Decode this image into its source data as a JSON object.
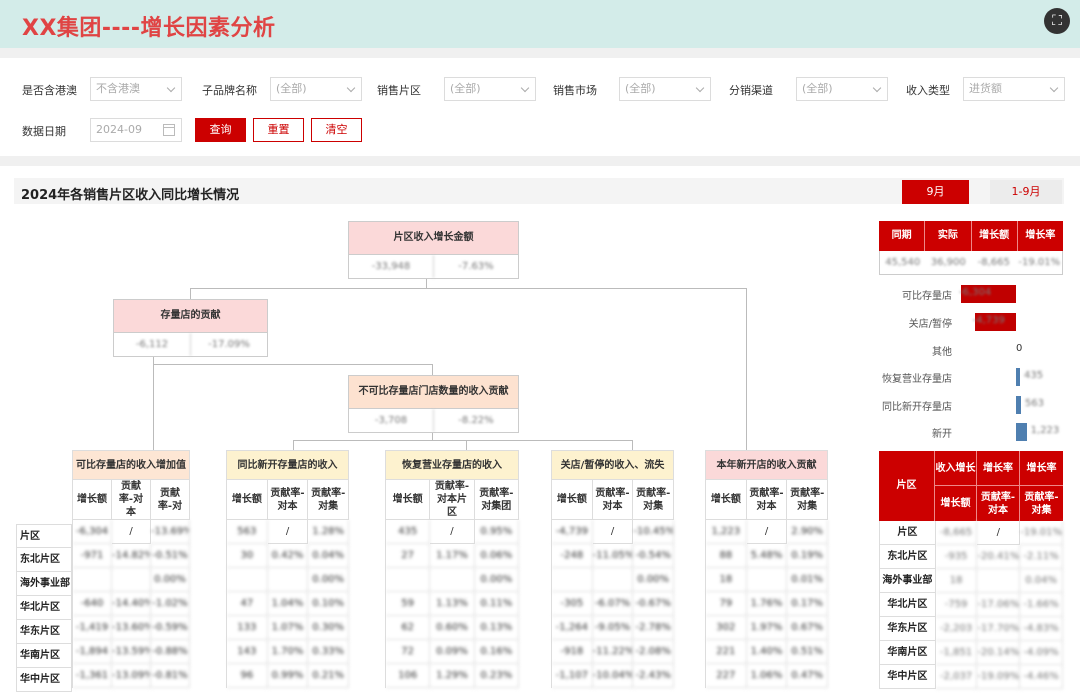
{
  "app": {
    "title": "XX集团----增长因素分析",
    "fullscreen_icon": "fullscreen-icon"
  },
  "filters": {
    "hk_macao": {
      "label": "是否含港澳",
      "value": "不含港澳"
    },
    "sub_brand": {
      "label": "子品牌名称",
      "value": "(全部)"
    },
    "sales_region": {
      "label": "销售片区",
      "value": "(全部)"
    },
    "sales_market": {
      "label": "销售市场",
      "value": "(全部)"
    },
    "channel": {
      "label": "分销渠道",
      "value": "(全部)"
    },
    "income_type": {
      "label": "收入类型",
      "value": "进货额"
    },
    "data_date": {
      "label": "数据日期",
      "value": "2024-09"
    },
    "buttons": {
      "query": "查询",
      "reset": "重置",
      "clear": "清空"
    }
  },
  "section": {
    "title": "2024年各销售片区收入同比增长情况",
    "tab_month": "9月",
    "tab_ytd": "1-9月"
  },
  "tree": {
    "root": {
      "title": "片区收入增长金额",
      "v1": "-33,948",
      "v2": "-7.63%"
    },
    "stock": {
      "title": "存量店的贡献",
      "v1": "-6,112",
      "v2": "-17.09%"
    },
    "noncomp": {
      "title": "不可比存量店门店数量的收入贡献",
      "v1": "-3,708",
      "v2": "-8.22%"
    }
  },
  "row_labels": [
    "片区",
    "东北片区",
    "海外事业部",
    "华北片区",
    "华东片区",
    "华南片区",
    "华中片区"
  ],
  "categories": [
    {
      "title": "可比存量店的收入增加值",
      "headers": [
        "增长额",
        "贡献率-对本",
        "贡献率-对"
      ],
      "rows": [
        [
          "-6,304",
          "/",
          "-13.69%"
        ],
        [
          "-971",
          "-14.82%",
          "-0.51%"
        ],
        [
          "",
          "",
          "0.00%"
        ],
        [
          "-640",
          "-14.40%",
          "-1.02%"
        ],
        [
          "-1,419",
          "-13.60%",
          "-0.59%"
        ],
        [
          "-1,894",
          "-13.59%",
          "-0.88%"
        ],
        [
          "-1,361",
          "-13.09%",
          "-0.81%"
        ]
      ]
    },
    {
      "title": "同比新开存量店的收入",
      "headers": [
        "增长额",
        "贡献率-对本",
        "贡献率-对集"
      ],
      "rows": [
        [
          "563",
          "/",
          "1.28%"
        ],
        [
          "30",
          "0.42%",
          "0.04%"
        ],
        [
          "",
          "",
          "0.00%"
        ],
        [
          "47",
          "1.04%",
          "0.10%"
        ],
        [
          "133",
          "1.07%",
          "0.30%"
        ],
        [
          "143",
          "1.70%",
          "0.33%"
        ],
        [
          "96",
          "0.99%",
          "0.21%"
        ]
      ]
    },
    {
      "title": "恢复营业存量店的收入",
      "headers": [
        "增长额",
        "贡献率-对本片区",
        "贡献率-对集团"
      ],
      "rows": [
        [
          "435",
          "/",
          "0.95%"
        ],
        [
          "27",
          "1.17%",
          "0.06%"
        ],
        [
          "",
          "",
          "0.00%"
        ],
        [
          "59",
          "1.13%",
          "0.11%"
        ],
        [
          "62",
          "0.60%",
          "0.13%"
        ],
        [
          "72",
          "0.09%",
          "0.16%"
        ],
        [
          "106",
          "1.29%",
          "0.23%"
        ]
      ]
    },
    {
      "title": "关店/暂停的收入、流失",
      "headers": [
        "增长额",
        "贡献率-对本",
        "贡献率-对集"
      ],
      "rows": [
        [
          "-4,739",
          "/",
          "-10.45%"
        ],
        [
          "-248",
          "-11.05%",
          "-0.54%"
        ],
        [
          "",
          "",
          "0.00%"
        ],
        [
          "-305",
          "-6.07%",
          "-0.67%"
        ],
        [
          "-1,264",
          "-9.05%",
          "-2.78%"
        ],
        [
          "-918",
          "-11.22%",
          "-2.08%"
        ],
        [
          "-1,107",
          "-10.04%",
          "-2.43%"
        ]
      ]
    },
    {
      "title": "本年新开店的收入贡献",
      "headers": [
        "增长额",
        "贡献率-对本",
        "贡献率-对集"
      ],
      "rows": [
        [
          "1,223",
          "/",
          "2.90%"
        ],
        [
          "88",
          "5.48%",
          "0.19%"
        ],
        [
          "18",
          "",
          "0.01%"
        ],
        [
          "79",
          "1.76%",
          "0.17%"
        ],
        [
          "302",
          "1.97%",
          "0.67%"
        ],
        [
          "221",
          "1.40%",
          "0.51%"
        ],
        [
          "227",
          "1.06%",
          "0.47%"
        ]
      ]
    }
  ],
  "right_summary": {
    "headers": [
      "同期",
      "实际",
      "增长额",
      "增长率"
    ],
    "values": [
      "45,540",
      "36,900",
      "-8,665",
      "-19.01%"
    ]
  },
  "right_bars": [
    {
      "label": "可比存量店",
      "value": "-6,304",
      "color": "#c00000"
    },
    {
      "label": "关店/暂停",
      "value": "-4,739",
      "color": "#c00000"
    },
    {
      "label": "其他",
      "value": "0",
      "color": "#ffffff"
    },
    {
      "label": "恢复营业存量店",
      "value": "435",
      "color": "#4f7fb0"
    },
    {
      "label": "同比新开存量店",
      "value": "563",
      "color": "#4f7fb0"
    },
    {
      "label": "新开",
      "value": "1,223",
      "color": "#4f7fb0"
    }
  ],
  "right_table": {
    "h_region": "片区",
    "h_income": "收入增长",
    "h_rate1": "增长率",
    "h_rate2": "增长率",
    "h_amount": "增长额",
    "h_contrib1": "贡献率-对本",
    "h_contrib2": "贡献率-对集",
    "rows": [
      [
        "片区",
        "-8,665",
        "/",
        "-19.01%"
      ],
      [
        "东北片区",
        "-935",
        "-20.41%",
        "-2.11%"
      ],
      [
        "海外事业部",
        "18",
        "",
        "0.04%"
      ],
      [
        "华北片区",
        "-759",
        "-17.06%",
        "-1.66%"
      ],
      [
        "华东片区",
        "-2,203",
        "-17.70%",
        "-4.83%"
      ],
      [
        "华南片区",
        "-1,851",
        "-20.14%",
        "-4.09%"
      ],
      [
        "华中片区",
        "-2,037",
        "-19.09%",
        "-4.46%"
      ]
    ]
  }
}
